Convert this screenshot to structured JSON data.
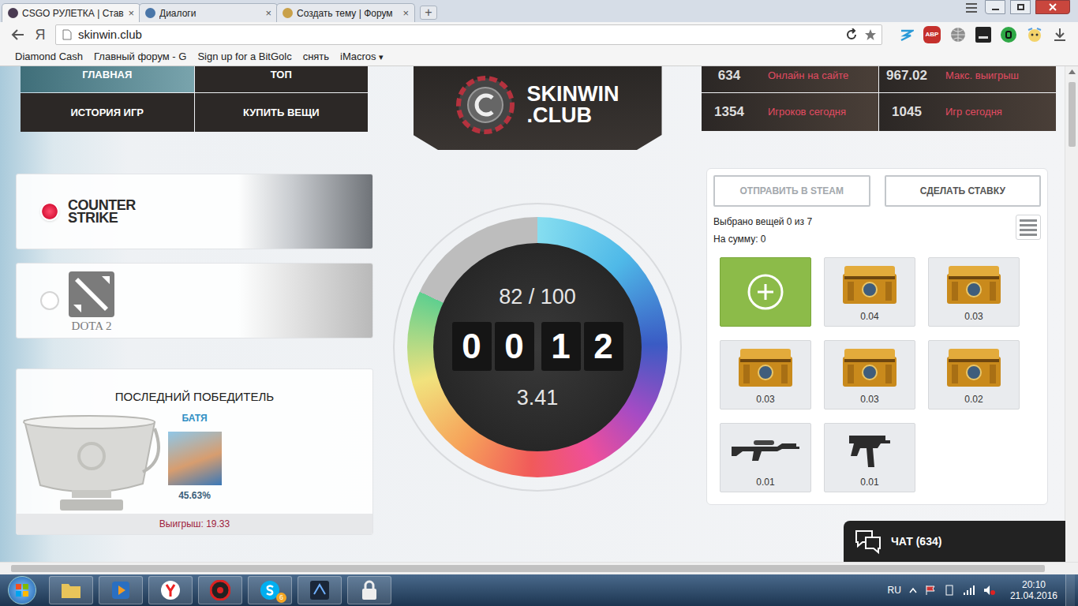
{
  "browser": {
    "tabs": [
      {
        "label": "CSGO РУЛЕТКА | Став",
        "close": "×",
        "selected": true
      },
      {
        "label": "Диалоги",
        "close": "×",
        "selected": false
      },
      {
        "label": "Создать тему | Форум",
        "close": "×",
        "selected": false
      }
    ],
    "new_tab": "+",
    "yandex_button": "Я",
    "url": "skinwin.club",
    "adblock_badge": "ABP",
    "bookmarks": [
      {
        "label": "Diamond Cash",
        "menu": ""
      },
      {
        "label": "Главный форум - G",
        "menu": ""
      },
      {
        "label": "Sign up for a BitGolc",
        "menu": ""
      },
      {
        "label": "снять",
        "menu": ""
      },
      {
        "label": "iMacros",
        "menu": "▾"
      }
    ]
  },
  "page": {
    "nav": [
      {
        "label": "ГЛАВНАЯ",
        "selected": true
      },
      {
        "label": "ТОП",
        "selected": false
      },
      {
        "label": "ИСТОРИЯ ИГР",
        "selected": false
      },
      {
        "label": "КУПИТЬ ВЕЩИ",
        "selected": false
      }
    ],
    "logo": {
      "name": "SKINWIN",
      "suffix": ".CLUB"
    },
    "stats": [
      {
        "value": "634",
        "label": "Онлайн на сайте"
      },
      {
        "value": "967.02",
        "label": "Макс. выигрыш"
      },
      {
        "value": "1354",
        "label": "Игроков сегодня"
      },
      {
        "value": "1045",
        "label": "Игр сегодня"
      }
    ],
    "games": [
      {
        "kind": "cs",
        "lines": [
          "COUNTER",
          "STRIKE"
        ],
        "selected": true
      },
      {
        "kind": "dota",
        "lines": [
          "DOTA 2"
        ],
        "selected": false
      }
    ],
    "last_winner": {
      "title": "ПОСЛЕДНИЙ ПОБЕДИТЕЛЬ",
      "name": "БАТЯ",
      "chance": "45.63%",
      "prize": "Выигрыш: 19.33"
    },
    "round": {
      "items": "82 / 100",
      "level": 0.82,
      "timer": [
        "0",
        "0",
        "1",
        "2"
      ],
      "bank": "3.41"
    },
    "inventory": {
      "buttons": [
        {
          "label": "ОТПРАВИТЬ В STEAM",
          "disabled": true
        },
        {
          "label": "СДЕЛАТЬ СТАВКУ",
          "disabled": false
        }
      ],
      "selected_count": "Выбрано вещей 0 из 7",
      "total": "На сумму: 0",
      "items": [
        {
          "kind": "add",
          "price": ""
        },
        {
          "kind": "case",
          "price": "0.04"
        },
        {
          "kind": "case",
          "price": "0.03"
        },
        {
          "kind": "case",
          "price": "0.03"
        },
        {
          "kind": "case",
          "price": "0.03"
        },
        {
          "kind": "case",
          "price": "0.02"
        },
        {
          "kind": "rifle",
          "price": "0.01"
        },
        {
          "kind": "smg",
          "price": "0.01"
        }
      ]
    },
    "chat": {
      "label": "ЧАТ (634)"
    }
  },
  "taskbar": {
    "skype_badge": "6",
    "language": "RU",
    "time": "20:10",
    "date": "21.04.2016"
  }
}
